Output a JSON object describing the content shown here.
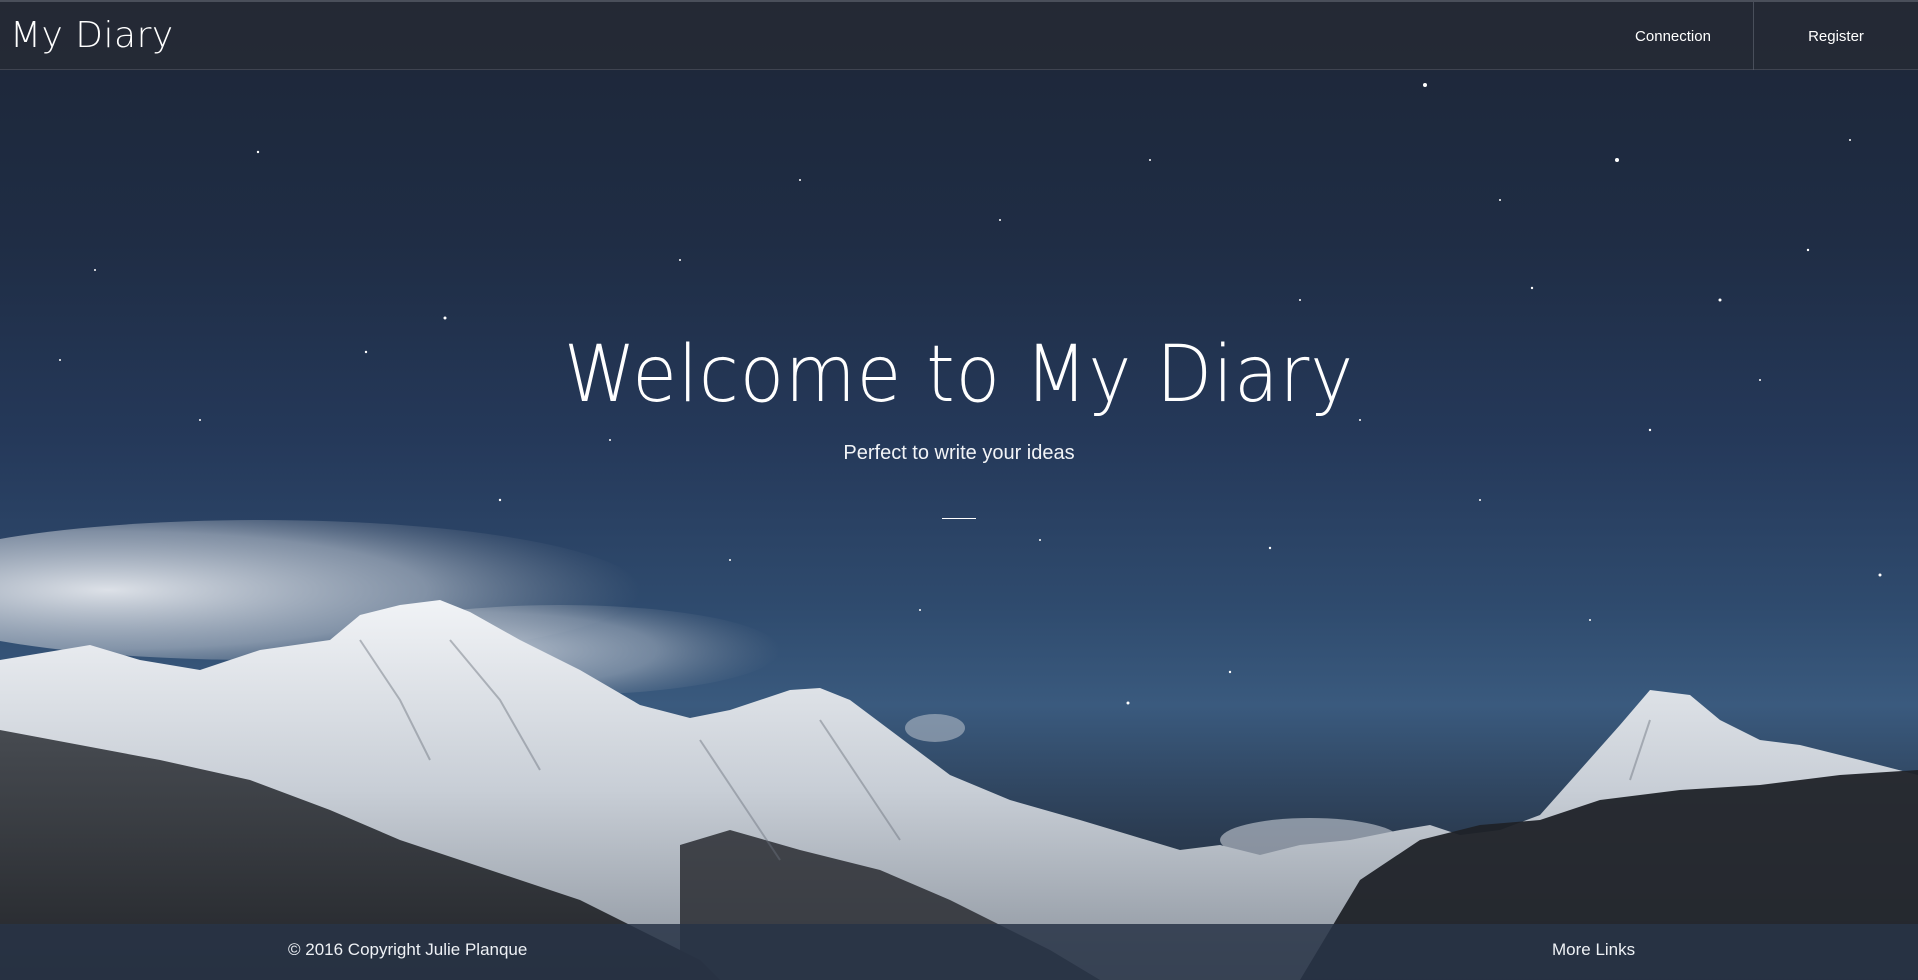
{
  "header": {
    "brand": "My Diary",
    "nav": [
      {
        "label": "Connection"
      },
      {
        "label": "Register"
      }
    ]
  },
  "hero": {
    "title": "Welcome to My Diary",
    "subtitle": "Perfect to write your ideas",
    "background_image": "starry-night-snowy-mountains"
  },
  "footer": {
    "copyright": "© 2016 Copyright Julie Planque",
    "links_label": "More Links"
  },
  "colors": {
    "nav_background": "#262a34",
    "sky_top": "#1d2637",
    "sky_bottom": "#3a5a7e",
    "text": "#ffffff"
  }
}
